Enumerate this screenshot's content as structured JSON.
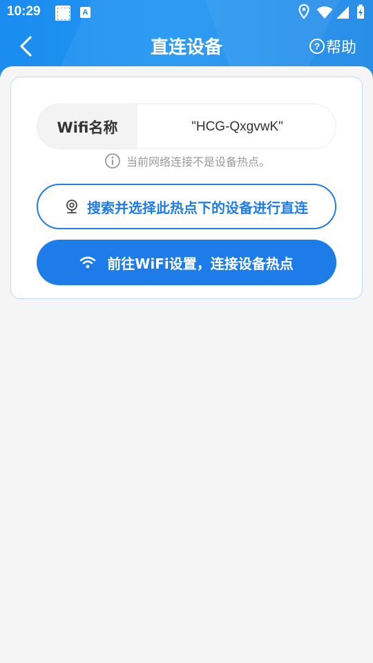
{
  "status_bar": {
    "time": "10:29",
    "notification_icon_1": "image-placeholder-icon",
    "notification_icon_2": "translate-a-icon",
    "notification_icon_2_text": "A",
    "right_icons": [
      "location-icon",
      "wifi-signal-icon",
      "cell-signal-icon",
      "battery-charging-icon"
    ]
  },
  "nav": {
    "title": "直连设备",
    "back_icon": "chevron-left-icon",
    "help_icon_text": "?",
    "help_label": "帮助"
  },
  "form": {
    "wifi_label": "Wifi名称",
    "wifi_value": "\"HCG-QxgvwK\"",
    "hint_text": "当前网络连接不是设备热点。",
    "search_button_label": "搜索并选择此热点下的设备进行直连",
    "settings_button_label": "前往WiFi设置，连接设备热点"
  },
  "colors": {
    "primary": "#1e7ce8",
    "header": "#2196f3",
    "background": "#f5f5f5",
    "card_border": "#b9dcf6"
  }
}
